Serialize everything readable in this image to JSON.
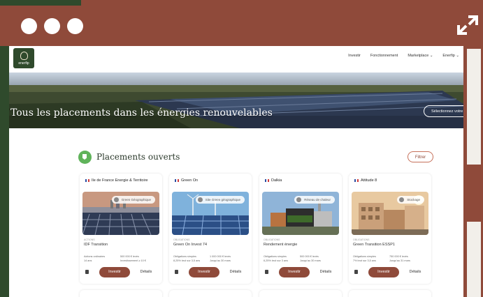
{
  "window": {
    "controls": [
      "dot-1",
      "dot-2",
      "dot-3"
    ],
    "expand_icon": "expand-icon",
    "colors": {
      "frame": "#8f4a3a",
      "accent": "#2f4a2c"
    }
  },
  "site": {
    "logo": {
      "text": "enerfip"
    },
    "nav": [
      "Investir",
      "Fonctionnement",
      "Marketplace ⌄",
      "Enerfip ⌄"
    ],
    "hero": {
      "title": "Tous les placements dans les énergies renouvelables",
      "button": "Sélectionnez votre"
    },
    "section": {
      "title": "Placements ouverts",
      "filter_label": "Filtrer"
    },
    "cards": [
      {
        "owner": "Ile de France Energie & Territoire",
        "badge": "Green Géographique",
        "category": "ACTIONS",
        "name": "IDF Transition",
        "meta": [
          "Actions ordinaires",
          "500 000 € levés",
          "14 ans",
          "Investissement ≥ 10 €"
        ],
        "invest": "Investir",
        "details": "Détails"
      },
      {
        "owner": "Green On",
        "badge": "Site Green géographique",
        "category": "OBLIGATIONS",
        "name": "Green On Invest 74",
        "meta": [
          "Obligations simples",
          "1 000 000 € levés",
          "8,25% brut sur 3,5 ans",
          "Jusqu'au 30 mars"
        ],
        "invest": "Investir",
        "details": "Détails"
      },
      {
        "owner": "Dalkia",
        "badge": "Réseau de chaleur",
        "category": "OBLIGATIONS",
        "name": "Rendement énergie",
        "meta": [
          "Obligations simples",
          "500 000 € levés",
          "6,25% brut sur 3 ans",
          "Jusqu'au 30 mars"
        ],
        "invest": "Investir",
        "details": "Détails"
      },
      {
        "owner": "Attitude 8",
        "badge": "Stockage",
        "category": "OBLIGATIONS",
        "name": "Green Transition ESSP1",
        "meta": [
          "Obligations simples",
          "750 000 € levés",
          "7% brut sur 3,5 ans",
          "Jusqu'au 31 mars"
        ],
        "invest": "Investir",
        "details": "Détails"
      }
    ]
  }
}
